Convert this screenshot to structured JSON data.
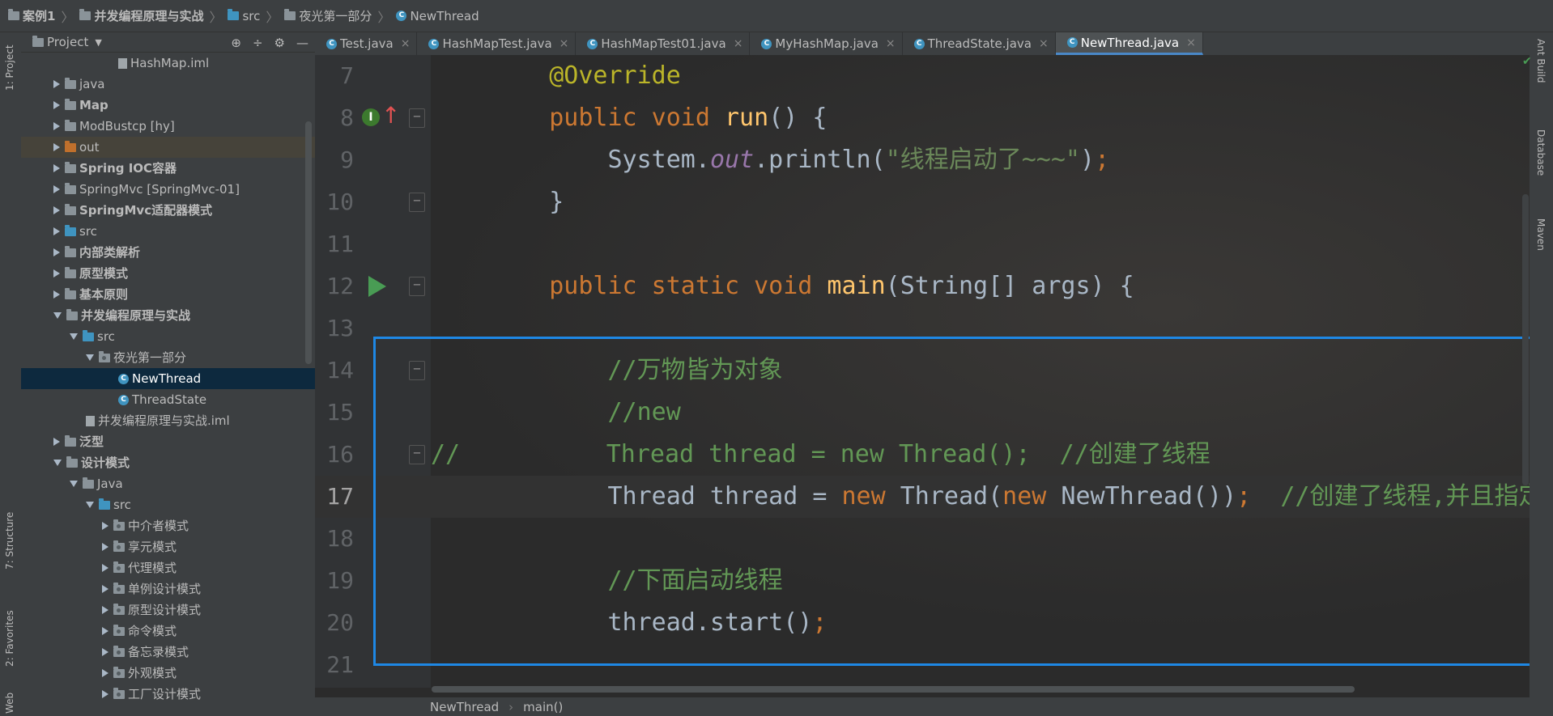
{
  "breadcrumb": [
    "案例1",
    "并发编程原理与实战",
    "src",
    "夜光第一部分",
    "NewThread"
  ],
  "left_strip": {
    "project_tab": "1: Project",
    "structure_tab": "7: Structure",
    "favorites_tab": "2: Favorites",
    "web_tab": "Web"
  },
  "project_panel": {
    "title": "Project",
    "tree": [
      {
        "label": "HashMap.iml",
        "indent": 5,
        "icon": "file-icon",
        "arrow": "none",
        "bold": false
      },
      {
        "label": "java",
        "indent": 1,
        "icon": "folder-icon",
        "arrow": "closed",
        "bold": false
      },
      {
        "label": "Map",
        "indent": 1,
        "icon": "folder-icon",
        "arrow": "closed",
        "bold": true
      },
      {
        "label": "ModBustcp [hy]",
        "indent": 1,
        "icon": "folder-icon",
        "arrow": "closed",
        "bold": false
      },
      {
        "label": "out",
        "indent": 1,
        "icon": "out-folder-icon",
        "arrow": "closed",
        "bold": false,
        "out": true
      },
      {
        "label": "Spring IOC容器",
        "indent": 1,
        "icon": "folder-icon",
        "arrow": "closed",
        "bold": true
      },
      {
        "label": "SpringMvc [SpringMvc-01]",
        "indent": 1,
        "icon": "folder-icon",
        "arrow": "closed",
        "bold": false
      },
      {
        "label": "SpringMvc适配器模式",
        "indent": 1,
        "icon": "folder-icon",
        "arrow": "closed",
        "bold": true
      },
      {
        "label": "src",
        "indent": 1,
        "icon": "src-folder-icon",
        "arrow": "closed",
        "bold": false
      },
      {
        "label": "内部类解析",
        "indent": 1,
        "icon": "folder-icon",
        "arrow": "closed",
        "bold": true
      },
      {
        "label": "原型模式",
        "indent": 1,
        "icon": "folder-icon",
        "arrow": "closed",
        "bold": true
      },
      {
        "label": "基本原则",
        "indent": 1,
        "icon": "folder-icon",
        "arrow": "closed",
        "bold": true
      },
      {
        "label": "并发编程原理与实战",
        "indent": 1,
        "icon": "folder-icon",
        "arrow": "open",
        "bold": true
      },
      {
        "label": "src",
        "indent": 2,
        "icon": "src-folder-icon",
        "arrow": "open",
        "bold": false
      },
      {
        "label": "夜光第一部分",
        "indent": 3,
        "icon": "package-icon",
        "arrow": "open",
        "bold": false
      },
      {
        "label": "NewThread",
        "indent": 5,
        "icon": "class-icon",
        "arrow": "none",
        "bold": false,
        "selected": true
      },
      {
        "label": "ThreadState",
        "indent": 5,
        "icon": "class-icon",
        "arrow": "none",
        "bold": false
      },
      {
        "label": "并发编程原理与实战.iml",
        "indent": 3,
        "icon": "file-icon",
        "arrow": "none",
        "bold": false
      },
      {
        "label": "泛型",
        "indent": 1,
        "icon": "folder-icon",
        "arrow": "closed",
        "bold": true
      },
      {
        "label": "设计模式",
        "indent": 1,
        "icon": "folder-icon",
        "arrow": "open",
        "bold": true
      },
      {
        "label": "Java",
        "indent": 2,
        "icon": "folder-icon",
        "arrow": "open",
        "bold": false
      },
      {
        "label": "src",
        "indent": 3,
        "icon": "src-folder-icon",
        "arrow": "open",
        "bold": false
      },
      {
        "label": "中介者模式",
        "indent": 4,
        "icon": "package-icon",
        "arrow": "closed",
        "bold": false
      },
      {
        "label": "享元模式",
        "indent": 4,
        "icon": "package-icon",
        "arrow": "closed",
        "bold": false
      },
      {
        "label": "代理模式",
        "indent": 4,
        "icon": "package-icon",
        "arrow": "closed",
        "bold": false
      },
      {
        "label": "单例设计模式",
        "indent": 4,
        "icon": "package-icon",
        "arrow": "closed",
        "bold": false
      },
      {
        "label": "原型设计模式",
        "indent": 4,
        "icon": "package-icon",
        "arrow": "closed",
        "bold": false
      },
      {
        "label": "命令模式",
        "indent": 4,
        "icon": "package-icon",
        "arrow": "closed",
        "bold": false
      },
      {
        "label": "备忘录模式",
        "indent": 4,
        "icon": "package-icon",
        "arrow": "closed",
        "bold": false
      },
      {
        "label": "外观模式",
        "indent": 4,
        "icon": "package-icon",
        "arrow": "closed",
        "bold": false
      },
      {
        "label": "工厂设计模式",
        "indent": 4,
        "icon": "package-icon",
        "arrow": "closed",
        "bold": false
      }
    ]
  },
  "tabs": [
    {
      "label": "Test.java",
      "active": false
    },
    {
      "label": "HashMapTest.java",
      "active": false
    },
    {
      "label": "HashMapTest01.java",
      "active": false
    },
    {
      "label": "MyHashMap.java",
      "active": false
    },
    {
      "label": "ThreadState.java",
      "active": false
    },
    {
      "label": "NewThread.java",
      "active": true
    }
  ],
  "right_strip": {
    "ant_tab": "Ant Build",
    "database_tab": "Database",
    "maven_tab": "Maven"
  },
  "editor": {
    "lines": [
      {
        "n": "7",
        "fold": false,
        "segments": [
          [
            "ann",
            "    @Override"
          ]
        ]
      },
      {
        "n": "8",
        "fold": true,
        "marker": "override",
        "segments": [
          [
            "kw",
            "    public void "
          ],
          [
            "fn",
            "run"
          ],
          [
            "txt",
            "() {"
          ]
        ]
      },
      {
        "n": "9",
        "fold": false,
        "segments": [
          [
            "txt",
            "        System."
          ],
          [
            "it",
            "out"
          ],
          [
            "txt",
            ".println("
          ],
          [
            "str",
            "\"线程启动了~~~\""
          ],
          [
            "txt",
            ")"
          ],
          [
            "kw",
            ";"
          ]
        ]
      },
      {
        "n": "10",
        "fold": true,
        "segments": [
          [
            "txt",
            "    }"
          ]
        ]
      },
      {
        "n": "11",
        "fold": false,
        "segments": []
      },
      {
        "n": "12",
        "fold": true,
        "marker": "run",
        "segments": [
          [
            "kw",
            "    public static void "
          ],
          [
            "fn",
            "main"
          ],
          [
            "txt",
            "(String[] args) {"
          ]
        ]
      },
      {
        "n": "13",
        "fold": false,
        "segments": []
      },
      {
        "n": "14",
        "fold": true,
        "segments": [
          [
            "cm",
            "        //万物皆为对象"
          ]
        ]
      },
      {
        "n": "15",
        "fold": false,
        "segments": [
          [
            "cm",
            "        //new"
          ]
        ]
      },
      {
        "n": "16",
        "fold": true,
        "segments": [
          [
            "cm",
            "//          Thread thread = new Thread();  //创建了线程"
          ]
        ]
      },
      {
        "n": "17",
        "fold": false,
        "current": true,
        "segments": [
          [
            "txt",
            "        Thread thread = "
          ],
          [
            "kw",
            "new "
          ],
          [
            "txt",
            "Thread("
          ],
          [
            "kw",
            "new "
          ],
          [
            "txt",
            "NewThread())"
          ],
          [
            "kw",
            ";"
          ],
          [
            "cm",
            "  //创建了线程,并且指定了"
          ]
        ]
      },
      {
        "n": "18",
        "fold": false,
        "segments": []
      },
      {
        "n": "19",
        "fold": false,
        "segments": [
          [
            "cm",
            "        //下面启动线程"
          ]
        ]
      },
      {
        "n": "20",
        "fold": false,
        "segments": [
          [
            "txt",
            "        thread.start()"
          ],
          [
            "kw",
            ";"
          ]
        ]
      },
      {
        "n": "21",
        "fold": false,
        "segments": []
      }
    ]
  },
  "status": {
    "class_name": "NewThread",
    "method_name": "main()"
  },
  "colors": {
    "background": "#2b2b2b",
    "panel": "#3c3f41",
    "keyword": "#cc7832",
    "string": "#6a8759",
    "comment": "#629755",
    "function": "#ffc66d",
    "annotation": "#bbb529",
    "highlight_box": "#1e88e5"
  }
}
